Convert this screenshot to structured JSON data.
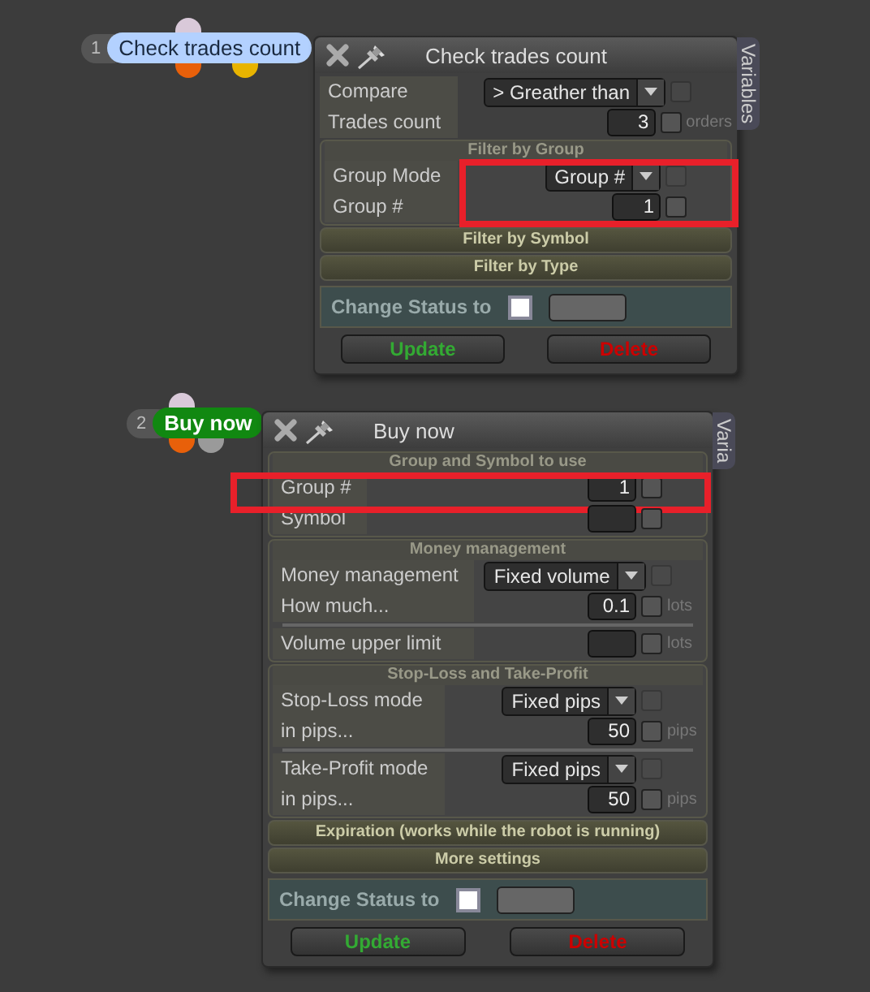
{
  "blocks": [
    {
      "number": "1",
      "label": "Check trades count",
      "color": "#b3d1ff",
      "inputs": [
        {
          "color": "#d9c9d9"
        }
      ],
      "outputs": [
        {
          "color": "#e8600a"
        },
        {
          "color": "#e8b400"
        }
      ],
      "title": "Check trades count",
      "side_tab": "Variables",
      "sections": [
        {
          "kind": "plain",
          "rows": [
            {
              "kind": "dropdown",
              "label": "Compare",
              "value": "> Greather than",
              "checked": false
            },
            {
              "kind": "input",
              "label": "Trades count",
              "value": "3",
              "unit": "orders",
              "checked": false
            }
          ]
        },
        {
          "kind": "group",
          "title": "Filter by Group",
          "highlight": true,
          "rows": [
            {
              "kind": "dropdown",
              "label": "Group Mode",
              "value": "Group #",
              "checked": false
            },
            {
              "kind": "input",
              "label": "Group #",
              "value": "1",
              "checked": false
            }
          ]
        },
        {
          "kind": "collapsed",
          "title": "Filter by Symbol"
        },
        {
          "kind": "collapsed",
          "title": "Filter by Type"
        }
      ],
      "status_label": "Change Status to",
      "status_checked": false,
      "buttons": [
        {
          "label": "Update",
          "color": "#33aa33"
        },
        {
          "label": "Delete",
          "color": "#cc0000"
        }
      ]
    },
    {
      "number": "2",
      "label": "Buy now",
      "color": "#118811",
      "inputs": [
        {
          "color": "#d9c9d9"
        }
      ],
      "outputs": [
        {
          "color": "#e8600a"
        },
        {
          "color": "#9a9a9a"
        }
      ],
      "title": "Buy now",
      "side_tab": "Varia",
      "sections": [
        {
          "kind": "group",
          "title": "Group and Symbol to use",
          "rows": [
            {
              "kind": "input",
              "label": "Group #",
              "value": "1",
              "checked": false,
              "highlighted": true
            },
            {
              "kind": "input",
              "label": "Symbol",
              "value": "",
              "checked": false
            }
          ]
        },
        {
          "kind": "group",
          "title": "Money management",
          "rows": [
            {
              "kind": "dropdown",
              "label": "Money management",
              "value": "Fixed volume",
              "checked": false
            },
            {
              "kind": "input",
              "label": "How much...",
              "value": "0.1",
              "unit": "lots",
              "checked": false
            },
            {
              "kind": "divider"
            },
            {
              "kind": "input",
              "label": "Volume upper limit",
              "value": "",
              "unit": "lots",
              "checked": false
            }
          ]
        },
        {
          "kind": "group",
          "title": "Stop-Loss and Take-Profit",
          "rows": [
            {
              "kind": "dropdown",
              "label": "Stop-Loss mode",
              "value": "Fixed pips",
              "checked": false
            },
            {
              "kind": "input",
              "label": "in pips...",
              "value": "50",
              "unit": "pips",
              "checked": false
            },
            {
              "kind": "divider"
            },
            {
              "kind": "dropdown",
              "label": "Take-Profit mode",
              "value": "Fixed pips",
              "checked": false
            },
            {
              "kind": "input",
              "label": "in pips...",
              "value": "50",
              "unit": "pips",
              "checked": false
            }
          ]
        },
        {
          "kind": "collapsed",
          "title": "Expiration (works while the robot is running)"
        },
        {
          "kind": "collapsed",
          "title": "More settings"
        }
      ],
      "status_label": "Change Status to",
      "status_checked": false,
      "buttons": [
        {
          "label": "Update",
          "color": "#33aa33"
        },
        {
          "label": "Delete",
          "color": "#cc0000"
        }
      ]
    }
  ]
}
